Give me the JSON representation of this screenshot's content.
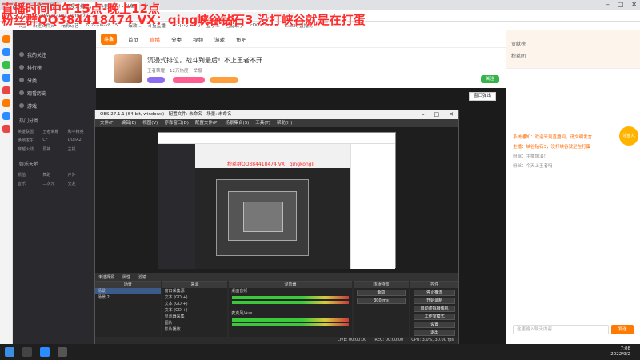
{
  "browser": {
    "tabs": [
      {
        "label": "直播间标题 - 斗鱼直播"
      },
      {
        "label": "沉浸式排位，战斗到最后! - 斗鱼",
        "active": true
      }
    ],
    "new_tab": "+",
    "url": "www.douyu.com/577...",
    "bookmarks": [
      "书签",
      "新建文件夹",
      "精彩综艺",
      "2022-08-28 15...",
      "爆款...",
      "斗鱼直播",
      "xx qing kong",
      "盒子...",
      "智能助手",
      "EDG-Flandre",
      "Thesky直播间"
    ]
  },
  "overlay": {
    "line1": "直播时间中午15点-晚上12点",
    "line2": "粉丝群QQ384418474   VX：qingkongli",
    "line3": "峡谷钻石3 没打峡谷就是在打蛋"
  },
  "douyu": {
    "logo": "斗鱼",
    "nav": [
      "首页",
      "直播",
      "分类",
      "视频",
      "游戏",
      "鱼吧"
    ],
    "active_nav": "直播",
    "room_title": "沉浸式排位，战斗到最后！不上王者不开...",
    "room_meta": [
      "王者荣耀",
      "12万热度",
      "举报"
    ],
    "follow": "关注",
    "popout_label": "窗口弹出"
  },
  "sidebar": {
    "items": [
      "我的关注",
      "排行榜",
      "分类",
      "观看历史",
      "游戏"
    ],
    "section_a": "热门分类",
    "grid_a": [
      "英雄联盟",
      "王者荣耀",
      "和平精英",
      "绝地求生",
      "CF",
      "DOTA2",
      "穿越火线",
      "原神",
      "主机"
    ],
    "section_b": "娱乐天地",
    "grid_b": [
      "颜值",
      "舞蹈",
      "户外",
      "音乐",
      "二次元",
      "交友"
    ]
  },
  "chat": {
    "head_lines": [
      "贡献榜",
      "粉丝团"
    ],
    "messages": [
      "系统通知：欢迎来到直播间，请文明发言",
      "主播：峡谷钻石3，没打峡谷就是在打蛋",
      "粉丝：主播加油！",
      "粉丝：今天上王者吗"
    ],
    "input_placeholder": "这里输入聊天内容",
    "send": "发送",
    "badge": "领鱼丸"
  },
  "obs": {
    "title": "OBS 27.1.1 (64-bit, windows) - 配置文件: 未命名 - 场景: 未命名",
    "menu": [
      "文件(F)",
      "编辑(E)",
      "视图(V)",
      "停靠窗口(D)",
      "配置文件(P)",
      "场景集合(S)",
      "工具(T)",
      "帮助(H)"
    ],
    "nested_caption": "粉丝群QQ384418474  VX：qingkongli",
    "srcbar": [
      "未选择源",
      "属性",
      "滤镜"
    ],
    "docks": {
      "scenes": {
        "title": "场景",
        "items": [
          "场景",
          "场景 2"
        ]
      },
      "sources": {
        "title": "来源",
        "items": [
          "窗口采集源",
          "文本 (GDI+)",
          "文本 (GDI+)",
          "文本 (GDI+)",
          "显示器采集",
          "图片",
          "影片播放"
        ]
      },
      "mixer": {
        "title": "混音器",
        "channels": [
          "桌面音频",
          "麦克风/Aux"
        ]
      },
      "transitions": {
        "title": "转场特效",
        "type": "渐隐",
        "duration": "300 ms"
      },
      "controls": {
        "title": "控件",
        "buttons": [
          "停止推流",
          "开始录制",
          "启动虚拟摄像机",
          "工作室模式",
          "设置",
          "退出"
        ]
      }
    },
    "status": [
      "LIVE: 00:00:00",
      "REC: 00:00:00",
      "CPU: 3.0%, 30.00 fps"
    ]
  },
  "taskbar": {
    "time": "7:08",
    "date": "2022/9/2"
  },
  "colors": {
    "overlay_red": "#ff2b2b",
    "douyu_orange": "#ff7a00",
    "douyu_dark": "#2a2a2e"
  }
}
